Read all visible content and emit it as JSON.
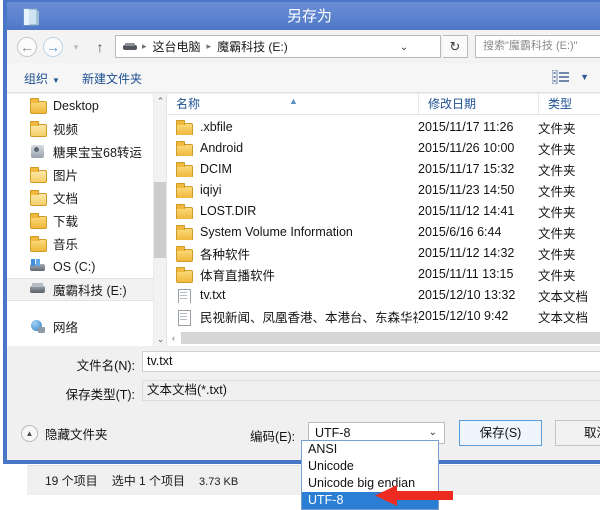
{
  "window": {
    "title": "另存为",
    "title_icon": "notepad-icon"
  },
  "navigation": {
    "back_icon": "←",
    "forward_icon": "→",
    "recent_icon": "▾",
    "up_icon": "↑",
    "refresh_icon": "↻",
    "address_chevron": "⌄",
    "breadcrumbs": [
      "这台电脑",
      "魔霸科技 (E:)"
    ],
    "separator": "▸",
    "search_placeholder": "搜索\"魔霸科技 (E:)\""
  },
  "toolbar": {
    "organize_label": "组织",
    "organize_caret": "▼",
    "new_folder_label": "新建文件夹",
    "view_caret": "▼"
  },
  "sidebar": {
    "items": [
      {
        "label": "Desktop",
        "icon": "folder-desktop-icon",
        "selected": false
      },
      {
        "label": "视频",
        "icon": "folder-videos-icon",
        "selected": false
      },
      {
        "label": "糖果宝宝68转运",
        "icon": "contacts-icon",
        "selected": false
      },
      {
        "label": "图片",
        "icon": "folder-pictures-icon",
        "selected": false
      },
      {
        "label": "文档",
        "icon": "folder-documents-icon",
        "selected": false
      },
      {
        "label": "下载",
        "icon": "folder-downloads-icon",
        "selected": false
      },
      {
        "label": "音乐",
        "icon": "folder-music-icon",
        "selected": false
      },
      {
        "label": "OS (C:)",
        "icon": "os-drive-icon",
        "selected": false
      },
      {
        "label": "魔霸科技 (E:)",
        "icon": "drive-icon",
        "selected": true
      },
      {
        "label": "网络",
        "icon": "network-icon",
        "selected": false
      }
    ],
    "scroll_up_icon": "⌃",
    "scroll_down_icon": "⌄"
  },
  "filelist": {
    "columns": [
      "名称",
      "修改日期",
      "类型"
    ],
    "sort_indicator": "▲",
    "rows": [
      {
        "name": ".xbfile",
        "date": "2015/11/17 11:26",
        "type": "文件夹",
        "icon": "folder-icon"
      },
      {
        "name": "Android",
        "date": "2015/11/26 10:00",
        "type": "文件夹",
        "icon": "folder-icon"
      },
      {
        "name": "DCIM",
        "date": "2015/11/17 15:32",
        "type": "文件夹",
        "icon": "folder-icon"
      },
      {
        "name": "iqiyi",
        "date": "2015/11/23 14:50",
        "type": "文件夹",
        "icon": "folder-icon"
      },
      {
        "name": "LOST.DIR",
        "date": "2015/11/12 14:41",
        "type": "文件夹",
        "icon": "folder-icon"
      },
      {
        "name": "System Volume Information",
        "date": "2015/6/16 6:44",
        "type": "文件夹",
        "icon": "folder-icon"
      },
      {
        "name": "各种软件",
        "date": "2015/11/12 14:32",
        "type": "文件夹",
        "icon": "folder-icon"
      },
      {
        "name": "体育直播软件",
        "date": "2015/11/11 13:15",
        "type": "文件夹",
        "icon": "folder-icon"
      },
      {
        "name": "tv.txt",
        "date": "2015/12/10 13:32",
        "type": "文本文档",
        "icon": "text-document-icon"
      },
      {
        "name": "民视新闻、凤凰香港、本港台、东森华视...",
        "date": "2015/12/10 9:42",
        "type": "文本文档",
        "icon": "text-document-icon"
      }
    ],
    "hscroll_left_icon": "‹"
  },
  "form": {
    "filename_label": "文件名(N):",
    "filename_value": "tv.txt",
    "savetype_label": "保存类型(T):",
    "savetype_value": "文本文档(*.txt)"
  },
  "bottom": {
    "hide_folders_label": "隐藏文件夹",
    "hide_folders_icon": "▲",
    "encoding_label": "编码(E):",
    "encoding_value": "UTF-8",
    "encoding_caret": "⌄",
    "save_label": "保存(S)",
    "cancel_label": "取消"
  },
  "encoding_dropdown": {
    "options": [
      {
        "label": "ANSI",
        "selected": false
      },
      {
        "label": "Unicode",
        "selected": false
      },
      {
        "label": "Unicode big endian",
        "selected": false
      },
      {
        "label": "UTF-8",
        "selected": true
      }
    ],
    "pointer_color": "#ee2b20"
  },
  "background_window": {
    "item_count": "19 个项目",
    "selection": "选中 1 个项目",
    "selected_size": "3.73 KB"
  },
  "colors": {
    "title_bar": "#5d84cf",
    "window_border": "#4a76c8",
    "link_blue": "#1d4f91",
    "selection_blue": "#2a7fd4",
    "accent_red": "#ee2b20"
  }
}
